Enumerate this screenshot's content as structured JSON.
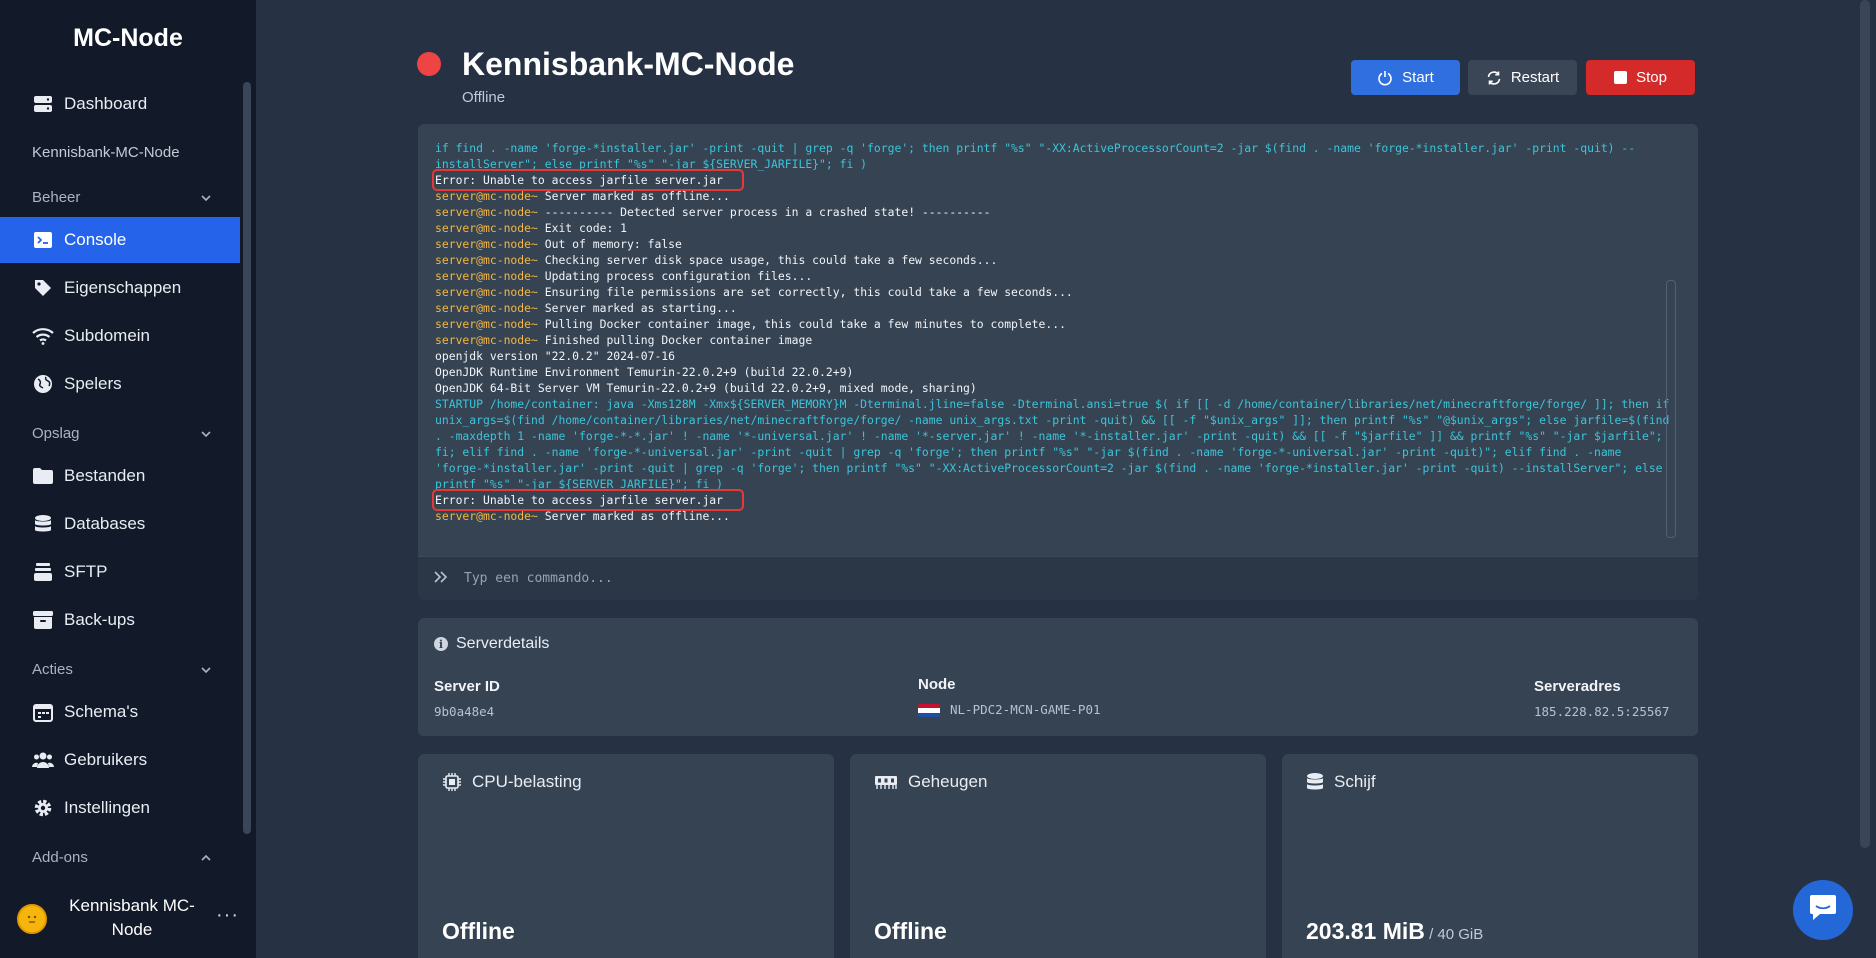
{
  "sidebar": {
    "brand": "MC-Node",
    "server_name": "Kennisbank-MC-Node",
    "items": {
      "dashboard": "Dashboard",
      "console": "Console",
      "eigenschappen": "Eigenschappen",
      "subdomein": "Subdomein",
      "spelers": "Spelers",
      "bestanden": "Bestanden",
      "databases": "Databases",
      "sftp": "SFTP",
      "backups": "Back-ups",
      "schemas": "Schema's",
      "gebruikers": "Gebruikers",
      "instellingen": "Instellingen"
    },
    "groups": {
      "beheer": "Beheer",
      "opslag": "Opslag",
      "acties": "Acties",
      "addons": "Add-ons"
    },
    "user": {
      "name": "Kennisbank MC-Node",
      "more": "···"
    }
  },
  "header": {
    "title": "Kennisbank-MC-Node",
    "status": "Offline",
    "status_color": "#ef4444",
    "buttons": {
      "start": "Start",
      "restart": "Restart",
      "stop": "Stop"
    }
  },
  "console": {
    "lines": [
      {
        "type": "cyan",
        "text": "if find . -name 'forge-*installer.jar' -print -quit | grep -q 'forge'; then printf \"%s\" \"-XX:ActiveProcessorCount=2 -jar $(find . -name 'forge-*installer.jar' -print -quit) --installServer\"; else printf \"%s\" \"-jar ${SERVER_JARFILE}\"; fi )"
      },
      {
        "type": "error",
        "text": "Error: Unable to access jarfile server.jar"
      },
      {
        "type": "prompt",
        "prompt": "server@mc-node~",
        "text": " Server marked as offline..."
      },
      {
        "type": "prompt",
        "prompt": "server@mc-node~",
        "text": " ---------- Detected server process in a crashed state! ----------"
      },
      {
        "type": "prompt",
        "prompt": "server@mc-node~",
        "text": " Exit code: 1"
      },
      {
        "type": "prompt",
        "prompt": "server@mc-node~",
        "text": " Out of memory: false"
      },
      {
        "type": "prompt",
        "prompt": "server@mc-node~",
        "text": " Checking server disk space usage, this could take a few seconds..."
      },
      {
        "type": "prompt",
        "prompt": "server@mc-node~",
        "text": " Updating process configuration files..."
      },
      {
        "type": "prompt",
        "prompt": "server@mc-node~",
        "text": " Ensuring file permissions are set correctly, this could take a few seconds..."
      },
      {
        "type": "prompt",
        "prompt": "server@mc-node~",
        "text": " Server marked as starting..."
      },
      {
        "type": "prompt",
        "prompt": "server@mc-node~",
        "text": " Pulling Docker container image, this could take a few minutes to complete..."
      },
      {
        "type": "prompt",
        "prompt": "server@mc-node~",
        "text": " Finished pulling Docker container image"
      },
      {
        "type": "plain",
        "text": "openjdk version \"22.0.2\" 2024-07-16"
      },
      {
        "type": "plain",
        "text": "OpenJDK Runtime Environment Temurin-22.0.2+9 (build 22.0.2+9)"
      },
      {
        "type": "plain",
        "text": "OpenJDK 64-Bit Server VM Temurin-22.0.2+9 (build 22.0.2+9, mixed mode, sharing)"
      },
      {
        "type": "cyan",
        "text": "STARTUP /home/container: java -Xms128M -Xmx${SERVER_MEMORY}M -Dterminal.jline=false -Dterminal.ansi=true $( if [[ -d /home/container/libraries/net/minecraftforge/forge/ ]]; then if unix_args=$(find /home/container/libraries/net/minecraftforge/forge/ -name unix_args.txt -print -quit) && [[ -f \"$unix_args\" ]]; then printf \"%s\" \"@$unix_args\"; else jarfile=$(find . -maxdepth 1 -name 'forge-*-*.jar' ! -name '*-universal.jar' ! -name '*-server.jar' ! -name '*-installer.jar' -print -quit) && [[ -f \"$jarfile\" ]] && printf \"%s\" \"-jar $jarfile\"; fi; elif find . -name 'forge-*-universal.jar' -print -quit | grep -q 'forge'; then printf \"%s\" \"-jar $(find . -name 'forge-*-universal.jar' -print -quit)\"; elif find . -name 'forge-*installer.jar' -print -quit | grep -q 'forge'; then printf \"%s\" \"-XX:ActiveProcessorCount=2 -jar $(find . -name 'forge-*installer.jar' -print -quit) --installServer\"; else printf \"%s\" \"-jar ${SERVER_JARFILE}\"; fi )"
      },
      {
        "type": "error",
        "text": "Error: Unable to access jarfile server.jar"
      },
      {
        "type": "prompt",
        "prompt": "server@mc-node~",
        "text": " Server marked as offline..."
      }
    ],
    "input_placeholder": "Typ een commando..."
  },
  "details": {
    "title": "Serverdetails",
    "server_id_label": "Server ID",
    "server_id": "9b0a48e4",
    "node_label": "Node",
    "node": "NL-PDC2-MCN-GAME-P01",
    "address_label": "Serveradres",
    "address": "185.228.82.5:25567"
  },
  "cards": {
    "cpu": {
      "title": "CPU-belasting",
      "value": "Offline"
    },
    "memory": {
      "title": "Geheugen",
      "value": "Offline"
    },
    "disk": {
      "title": "Schijf",
      "value": "203.81 MiB",
      "sub": " / 40 GiB"
    }
  },
  "colors": {
    "accent": "#2563eb",
    "stop": "#d42a2a",
    "console_cyan": "#3bc5d9",
    "console_prompt": "#f4b740"
  }
}
